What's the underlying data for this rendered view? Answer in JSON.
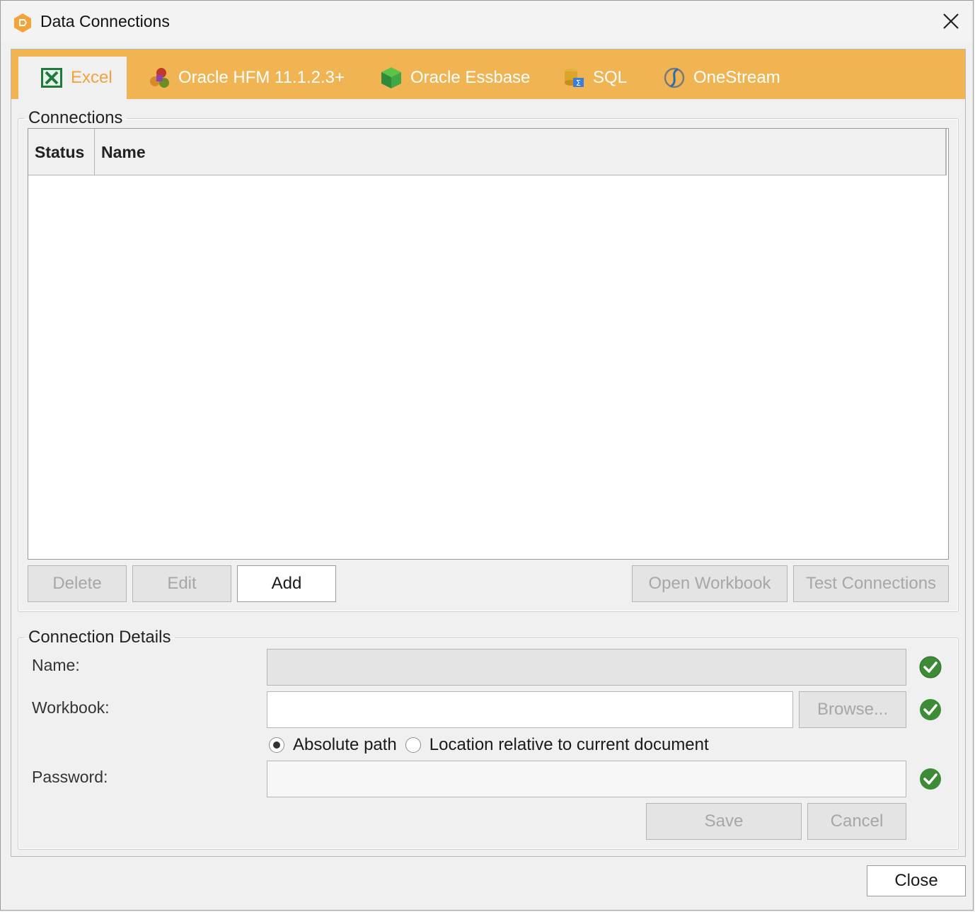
{
  "window": {
    "title": "Data Connections",
    "app_icon": "app-logo-icon",
    "close_icon": "close-icon"
  },
  "tabs": [
    {
      "label": "Excel",
      "icon": "excel-icon",
      "active": true
    },
    {
      "label": "Oracle HFM 11.1.2.3+",
      "icon": "oracle-hfm-icon",
      "active": false
    },
    {
      "label": "Oracle Essbase",
      "icon": "oracle-essbase-icon",
      "active": false
    },
    {
      "label": "SQL",
      "icon": "sql-icon",
      "active": false
    },
    {
      "label": "OneStream",
      "icon": "onestream-icon",
      "active": false
    }
  ],
  "connections": {
    "legend": "Connections",
    "columns": [
      "Status",
      "Name"
    ],
    "rows": [],
    "buttons": {
      "delete": "Delete",
      "edit": "Edit",
      "add": "Add",
      "open_workbook": "Open Workbook",
      "test_connections": "Test Connections"
    }
  },
  "details": {
    "legend": "Connection Details",
    "name_label": "Name:",
    "name_value": "",
    "workbook_label": "Workbook:",
    "workbook_value": "",
    "browse": "Browse...",
    "path_options": [
      {
        "label": "Absolute path",
        "selected": true
      },
      {
        "label": "Location relative to current document",
        "selected": false
      }
    ],
    "password_label": "Password:",
    "password_value": "",
    "save": "Save",
    "cancel": "Cancel",
    "valid_icon": "check-circle-icon"
  },
  "footer": {
    "close": "Close"
  },
  "colors": {
    "tab_strip": "#f1b452",
    "active_tab_text": "#f2a33a",
    "valid_green": "#3d8b37"
  }
}
